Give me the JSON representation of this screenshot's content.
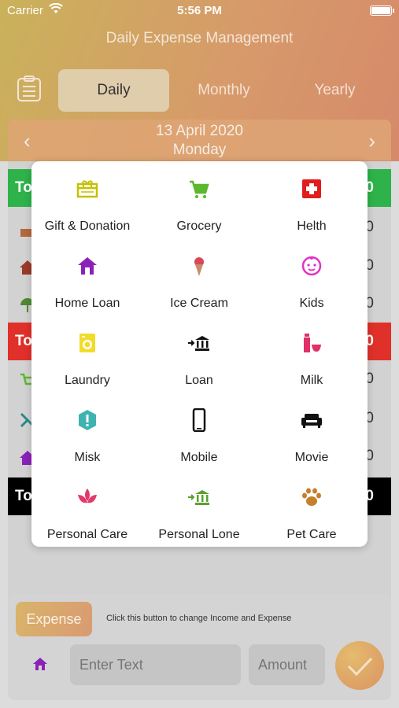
{
  "status": {
    "carrier": "Carrier",
    "time": "5:56 PM"
  },
  "app_title": "Daily Expense Management",
  "tabs": [
    {
      "label": "Daily",
      "selected": true
    },
    {
      "label": "Monthly",
      "selected": false
    },
    {
      "label": "Yearly",
      "selected": false
    }
  ],
  "date": {
    "line1": "13 April 2020",
    "line2": "Monday"
  },
  "background_list": {
    "income_band": {
      "label": "To",
      "value": "0",
      "color": "#2db34a"
    },
    "expense_band": {
      "label": "To",
      "value": "0",
      "color": "#e0302a"
    },
    "total_band": {
      "label": "To",
      "value": "0",
      "color": "#000000"
    },
    "row_value": "0"
  },
  "categories": [
    {
      "label": "Gift & Donation",
      "icon": "gift-icon",
      "color": "#c5c000"
    },
    {
      "label": "Grocery",
      "icon": "cart-icon",
      "color": "#5cb82e"
    },
    {
      "label": "Helth",
      "icon": "first-aid-icon",
      "color": "#e01e1e"
    },
    {
      "label": "Home Loan",
      "icon": "home-icon",
      "color": "#8a22b8"
    },
    {
      "label": "Ice Cream",
      "icon": "ice-cream-icon",
      "color": "#d9485a"
    },
    {
      "label": "Kids",
      "icon": "baby-face-icon",
      "color": "#e032c7"
    },
    {
      "label": "Laundry",
      "icon": "washing-machine-icon",
      "color": "#f2dc2a"
    },
    {
      "label": "Loan",
      "icon": "bank-icon",
      "color": "#111111"
    },
    {
      "label": "Milk",
      "icon": "milk-bottle-icon",
      "color": "#e0306a"
    },
    {
      "label": "Misk",
      "icon": "exclamation-icon",
      "color": "#3fb3b0"
    },
    {
      "label": "Mobile",
      "icon": "mobile-phone-icon",
      "color": "#111111"
    },
    {
      "label": "Movie",
      "icon": "sofa-icon",
      "color": "#111111"
    },
    {
      "label": "Personal Care",
      "icon": "lotus-icon",
      "color": "#e23a6a"
    },
    {
      "label": "Personal Lone",
      "icon": "bank-icon",
      "color": "#5aa12e"
    },
    {
      "label": "Pet Care",
      "icon": "paw-icon",
      "color": "#c4802a"
    }
  ],
  "bottom": {
    "expense_button": "Expense",
    "hint": "Click this button to change Income and Expense",
    "text_placeholder": "Enter Text",
    "amount_placeholder": "Amount"
  }
}
